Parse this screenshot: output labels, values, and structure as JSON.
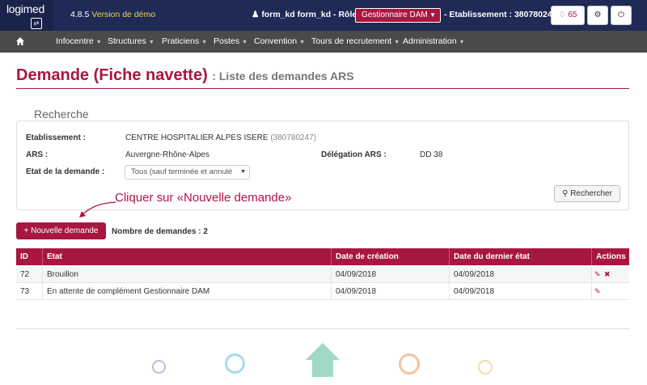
{
  "header": {
    "logo_text": "logimed",
    "version": "4.8.5",
    "demo_label": "Version de démo",
    "user_label": "form_kd form_kd - Rôle :",
    "role_value": "Gestionnaire DAM",
    "etablissement_label": "- Etablissement : 380780247",
    "notif_count": "65"
  },
  "nav": {
    "items": [
      {
        "label": "Infocentre"
      },
      {
        "label": "Structures"
      },
      {
        "label": "Praticiens"
      },
      {
        "label": "Postes"
      },
      {
        "label": "Convention"
      },
      {
        "label": "Tours de recrutement"
      },
      {
        "label": "Administration"
      }
    ]
  },
  "page": {
    "title": "Demande (Fiche navette)",
    "subtitle": ": Liste des demandes ARS"
  },
  "search": {
    "legend": "Recherche",
    "etablissement_label": "Etablissement :",
    "etablissement_value": "CENTRE HOSPITALIER ALPES ISERE",
    "etablissement_code": "(380780247)",
    "ars_label": "ARS :",
    "ars_value": "Auvergne-Rhône-Alpes",
    "delegation_label": "Délégation ARS :",
    "delegation_value": "DD 38",
    "etat_label": "Etat de la demande :",
    "etat_value": "Tous (sauf terminée et annulé",
    "search_button": "Rechercher"
  },
  "annotation": "Cliquer sur «Nouvelle demande»",
  "actions": {
    "new_button": "Nouvelle demande",
    "count_label": "Nombre de demandes : 2"
  },
  "table": {
    "headers": [
      "ID",
      "Etat",
      "Date de création",
      "Date du dernier état",
      "Actions"
    ],
    "rows": [
      {
        "id": "72",
        "etat": "Brouillon",
        "creation": "04/09/2018",
        "dernier": "04/09/2018"
      },
      {
        "id": "73",
        "etat": "En attente de complément Gestionnaire DAM",
        "creation": "04/09/2018",
        "dernier": "04/09/2018"
      }
    ]
  },
  "colors": {
    "brand": "#a8173f",
    "topbar": "#1f2a57",
    "nav": "#4a4a4a",
    "demo": "#f2d24a"
  }
}
